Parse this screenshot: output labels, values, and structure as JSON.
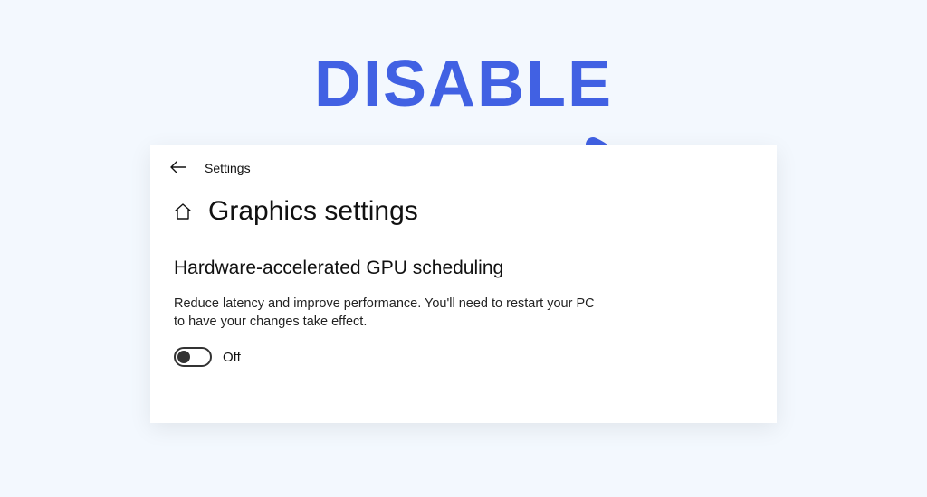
{
  "annotation": {
    "title": "DISABLE",
    "color": "#4161e3"
  },
  "window": {
    "header_label": "Settings",
    "page_title": "Graphics settings",
    "section": {
      "heading": "Hardware-accelerated GPU scheduling",
      "description": "Reduce latency and improve performance. You'll need to restart your PC to have your changes take effect.",
      "toggle": {
        "state": "off",
        "label": "Off"
      }
    }
  }
}
